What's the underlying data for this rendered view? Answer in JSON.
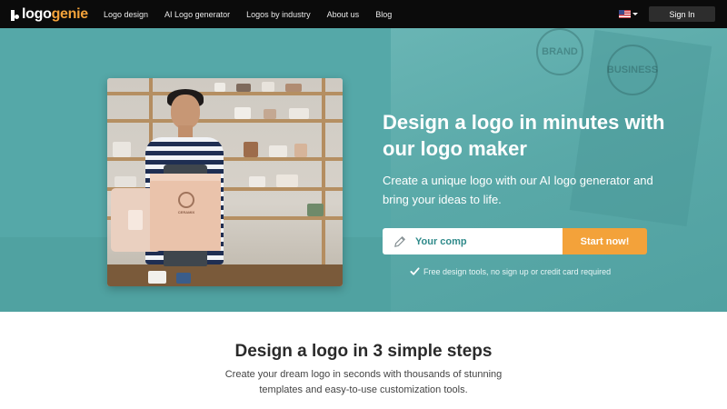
{
  "brand": {
    "part1": "logo",
    "part2": "genie",
    "accent_color": "#f3a23a"
  },
  "nav": {
    "links": [
      {
        "label": "Logo design"
      },
      {
        "label": "AI Logo generator"
      },
      {
        "label": "Logos by industry"
      },
      {
        "label": "About us"
      },
      {
        "label": "Blog"
      }
    ],
    "language_icon": "us-flag-icon",
    "signin_label": "Sign In"
  },
  "hero": {
    "title": "Design a logo in minutes with our logo maker",
    "subtitle": "Create a unique logo with our AI logo generator and bring your ideas to life.",
    "input": {
      "value": "Your comp",
      "icon": "pencil-icon"
    },
    "cta_label": "Start now!",
    "note": "Free design tools, no sign up or credit card required",
    "photo_box_text": "CERAMIX",
    "background_color": "#55a8a8",
    "stamp_texts": [
      "BRAND",
      "BUSINESS"
    ]
  },
  "steps": {
    "title": "Design a logo in 3 simple steps",
    "subtitle": "Create your dream logo in seconds with thousands of stunning templates and easy-to-use customization tools."
  }
}
